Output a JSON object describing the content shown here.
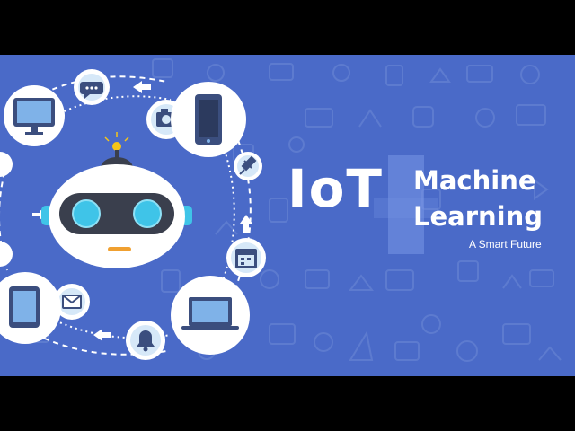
{
  "title": {
    "main": "IoT",
    "line1": "Machine",
    "line2": "Learning",
    "tagline": "A Smart Future"
  },
  "colors": {
    "background": "#4a6ac8",
    "robot_body": "#ffffff",
    "robot_visor": "#3a3f4d",
    "robot_eyes": "#3fc4e8",
    "robot_mouth": "#f0a030",
    "antenna_light": "#f5c518",
    "icon_bubble": "#d6e8f8",
    "icon_dark": "#3b4e7e"
  },
  "icons": [
    "monitor-icon",
    "chat-icon",
    "camera-icon",
    "smartphone-icon",
    "pin-icon",
    "calendar-icon",
    "laptop-icon",
    "bell-icon",
    "mail-icon",
    "tablet-icon",
    "robot-icon"
  ]
}
